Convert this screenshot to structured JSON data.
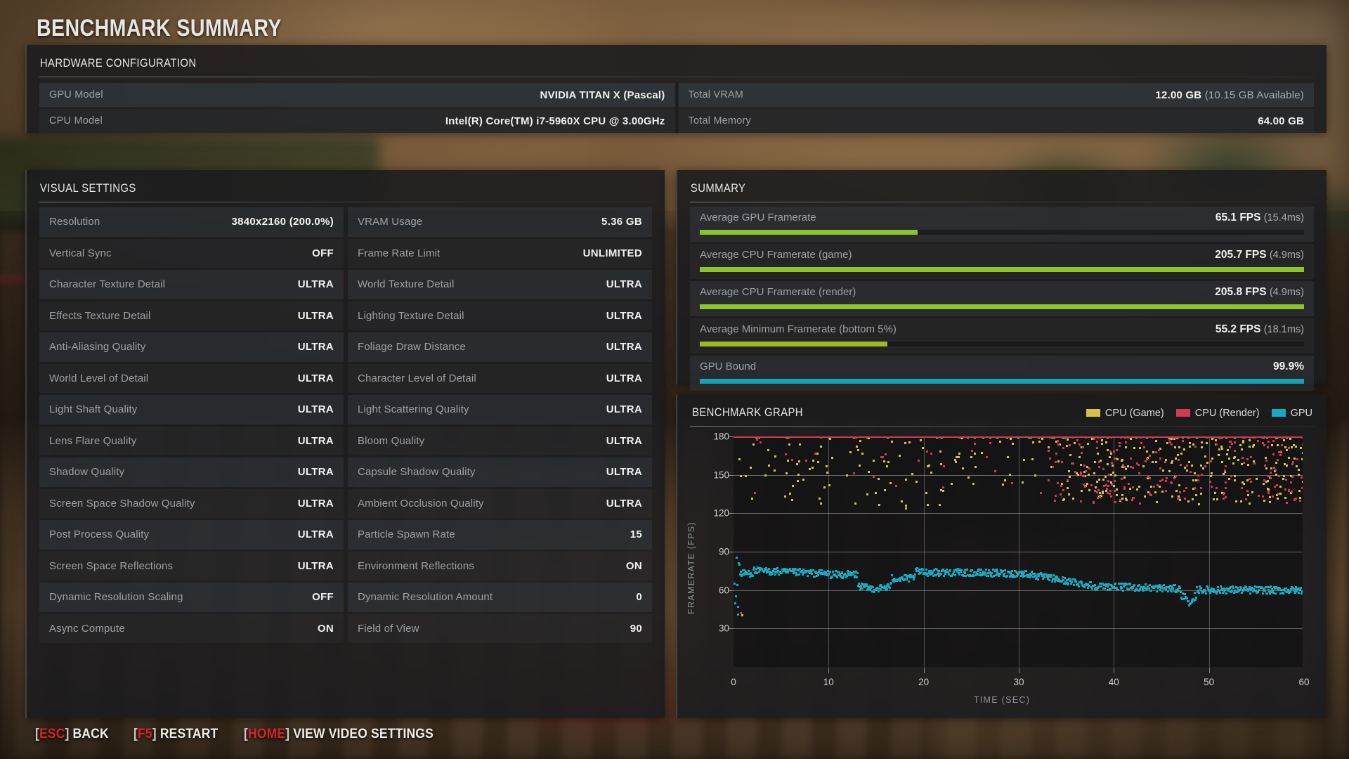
{
  "page_title": "BENCHMARK SUMMARY",
  "hardware": {
    "header": "HARDWARE CONFIGURATION",
    "left": [
      {
        "label": "GPU Model",
        "value": "NVIDIA TITAN X (Pascal)"
      },
      {
        "label": "CPU Model",
        "value": "Intel(R) Core(TM) i7-5960X CPU @ 3.00GHz"
      }
    ],
    "right": [
      {
        "label": "Total VRAM",
        "value": "12.00 GB",
        "sub": "(10.15 GB Available)"
      },
      {
        "label": "Total Memory",
        "value": "64.00 GB",
        "sub": ""
      }
    ]
  },
  "visual_settings": {
    "header": "VISUAL SETTINGS",
    "left": [
      {
        "label": "Resolution",
        "value": "3840x2160 (200.0%)"
      },
      {
        "label": "Vertical Sync",
        "value": "OFF"
      },
      {
        "label": "Character Texture Detail",
        "value": "ULTRA"
      },
      {
        "label": "Effects Texture Detail",
        "value": "ULTRA"
      },
      {
        "label": "Anti-Aliasing Quality",
        "value": "ULTRA"
      },
      {
        "label": "World Level of Detail",
        "value": "ULTRA"
      },
      {
        "label": "Light Shaft Quality",
        "value": "ULTRA"
      },
      {
        "label": "Lens Flare Quality",
        "value": "ULTRA"
      },
      {
        "label": "Shadow Quality",
        "value": "ULTRA"
      },
      {
        "label": "Screen Space Shadow Quality",
        "value": "ULTRA"
      },
      {
        "label": "Post Process Quality",
        "value": "ULTRA"
      },
      {
        "label": "Screen Space Reflections",
        "value": "ULTRA"
      },
      {
        "label": "Dynamic Resolution Scaling",
        "value": "OFF"
      },
      {
        "label": "Async Compute",
        "value": "ON"
      }
    ],
    "right": [
      {
        "label": "VRAM Usage",
        "value": "5.36 GB"
      },
      {
        "label": "Frame Rate Limit",
        "value": "UNLIMITED"
      },
      {
        "label": "World Texture Detail",
        "value": "ULTRA"
      },
      {
        "label": "Lighting Texture Detail",
        "value": "ULTRA"
      },
      {
        "label": "Foliage Draw Distance",
        "value": "ULTRA"
      },
      {
        "label": "Character Level of Detail",
        "value": "ULTRA"
      },
      {
        "label": "Light Scattering Quality",
        "value": "ULTRA"
      },
      {
        "label": "Bloom Quality",
        "value": "ULTRA"
      },
      {
        "label": "Capsule Shadow Quality",
        "value": "ULTRA"
      },
      {
        "label": "Ambient Occlusion Quality",
        "value": "ULTRA"
      },
      {
        "label": "Particle Spawn Rate",
        "value": "15"
      },
      {
        "label": "Environment Reflections",
        "value": "ON"
      },
      {
        "label": "Dynamic Resolution Amount",
        "value": "0"
      },
      {
        "label": "Field of View",
        "value": "90"
      }
    ]
  },
  "summary": {
    "header": "SUMMARY",
    "rows": [
      {
        "label": "Average GPU Framerate",
        "value": "65.1 FPS",
        "sub": "(15.4ms)",
        "pct": 36,
        "color": "#8bc52a"
      },
      {
        "label": "Average CPU Framerate (game)",
        "value": "205.7 FPS",
        "sub": "(4.9ms)",
        "pct": 100,
        "color": "#8bc52a"
      },
      {
        "label": "Average CPU Framerate (render)",
        "value": "205.8 FPS",
        "sub": "(4.9ms)",
        "pct": 100,
        "color": "#8bc52a"
      },
      {
        "label": "Average Minimum Framerate (bottom 5%)",
        "value": "55.2 FPS",
        "sub": "(18.1ms)",
        "pct": 31,
        "color": "#9cbb22"
      },
      {
        "label": "GPU Bound",
        "value": "99.9%",
        "sub": "",
        "pct": 100,
        "color": "#17a2b8"
      }
    ]
  },
  "graph": {
    "header": "BENCHMARK GRAPH",
    "legend": [
      {
        "label": "CPU (Game)",
        "color": "#d8c14a"
      },
      {
        "label": "CPU (Render)",
        "color": "#cf3b4f"
      },
      {
        "label": "GPU",
        "color": "#17a9c0"
      }
    ]
  },
  "chart_data": {
    "type": "scatter",
    "title": "BENCHMARK GRAPH",
    "xlabel": "TIME (SEC)",
    "ylabel": "FRAMERATE (FPS)",
    "xlim": [
      0,
      60
    ],
    "ylim": [
      0,
      180
    ],
    "xticks": [
      0,
      10,
      20,
      30,
      40,
      50,
      60
    ],
    "yticks": [
      0,
      30,
      60,
      90,
      120,
      150,
      180
    ],
    "grid": true,
    "legend_position": "top-right",
    "annotations": [
      "CPU series are clamped at the 180 FPS ceiling of the plot",
      "GPU series tracks ~60-80 FPS across the run, dipping near t=15s and t=48s"
    ],
    "series": [
      {
        "name": "CPU (Game)",
        "color": "#d8c14a",
        "point_count": 620,
        "y_mean": 160,
        "y_range": [
          118,
          180
        ],
        "notes": "Sparse yellow scatter 118-180 FPS for t<30s, becoming very dense 130-180 FPS after t=33s"
      },
      {
        "name": "CPU (Render)",
        "color": "#cf3b4f",
        "point_count": 520,
        "y_mean": 163,
        "y_range": [
          120,
          180
        ],
        "notes": "Few red points early (a handful near 40-55 FPS at t<1s), dense cluster 130-180 FPS after t=33s; solid red cap line drawn at 180"
      },
      {
        "name": "GPU",
        "color": "#17a9c0",
        "point_count": 900,
        "y_mean": 68,
        "y_range": [
          36,
          92
        ],
        "notes": "Tight teal band near 72-78 FPS from t=0-30s, dipping to ~62 around t=13-16s, drifting down to ~60 FPS after t=38s with a spike down to ~48 near t=48s"
      }
    ]
  },
  "footer": {
    "hotkeys": [
      {
        "key": "ESC",
        "label": "BACK"
      },
      {
        "key": "F5",
        "label": "RESTART"
      },
      {
        "key": "HOME",
        "label": "VIEW VIDEO SETTINGS"
      }
    ]
  }
}
